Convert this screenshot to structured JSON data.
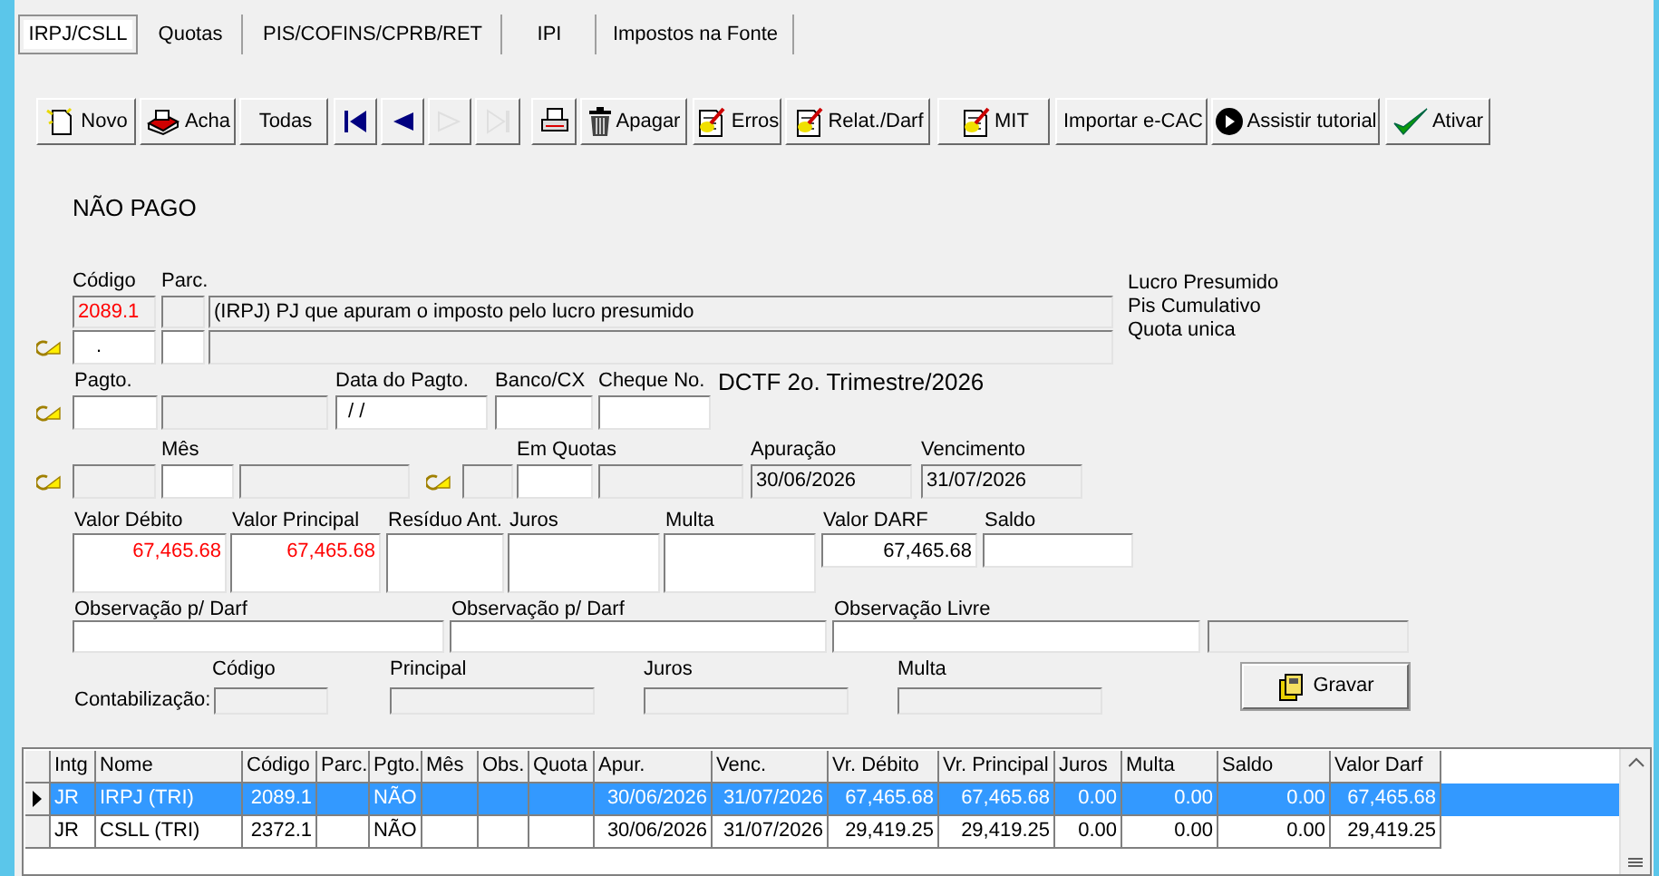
{
  "tabs": [
    {
      "label": "IRPJ/CSLL",
      "selected": true
    },
    {
      "label": "Quotas",
      "selected": false
    },
    {
      "label": "PIS/COFINS/CPRB/RET",
      "selected": false
    },
    {
      "label": "IPI",
      "selected": false
    },
    {
      "label": "Impostos na Fonte",
      "selected": false
    }
  ],
  "toolbar": [
    {
      "label": "Novo",
      "kind": "new",
      "disabled": false
    },
    {
      "label": "Acha",
      "kind": "find",
      "disabled": false
    },
    {
      "label": "Todas",
      "kind": "text",
      "disabled": false
    },
    {
      "kind": "first",
      "disabled": false
    },
    {
      "kind": "prev",
      "disabled": false
    },
    {
      "kind": "next",
      "disabled": true
    },
    {
      "kind": "last",
      "disabled": true
    },
    {
      "kind": "print",
      "disabled": false
    },
    {
      "label": "Apagar",
      "kind": "trash",
      "disabled": false
    },
    {
      "label": "Erros",
      "kind": "doc",
      "disabled": false
    },
    {
      "label": "Relat./Darf",
      "kind": "doc",
      "disabled": false
    },
    {
      "label": "MIT",
      "kind": "doc",
      "disabled": false
    },
    {
      "label": "Importar e-CAC",
      "kind": "text",
      "disabled": false
    },
    {
      "label": "Assistir tutorial",
      "kind": "play",
      "disabled": false
    },
    {
      "label": "Ativar",
      "kind": "check",
      "disabled": false
    }
  ],
  "status": "NÃO PAGO",
  "codigo": {
    "label": "Código",
    "parc_label": "Parc.",
    "value": "2089.1",
    "description": "(IRPJ) PJ que apuram o imposto pelo lucro presumido",
    "input_value": "."
  },
  "regime": [
    "Lucro Presumido",
    "Pis Cumulativo",
    "Quota unica"
  ],
  "pagamento": {
    "pagto_label": "Pagto.",
    "data_label": "Data do Pagto.",
    "data_value": "/ /",
    "banco_label": "Banco/CX",
    "cheque_label": "Cheque No.",
    "dctf": "DCTF 2o. Trimestre/2026"
  },
  "periodo": {
    "mes_label": "Mês",
    "quotas_label": "Em Quotas",
    "apuracao_label": "Apuração",
    "apuracao": "30/06/2026",
    "vencimento_label": "Vencimento",
    "vencimento": "31/07/2026"
  },
  "valores": [
    {
      "label": "Valor Débito",
      "value": "67,465.68",
      "emphasis": true
    },
    {
      "label": "Valor Principal",
      "value": "67,465.68",
      "emphasis": true
    },
    {
      "label": "Resíduo Ant."
    },
    {
      "label": "Juros"
    },
    {
      "label": "Multa"
    },
    {
      "label": "Valor DARF",
      "value": "67,465.68",
      "emphasis": false
    },
    {
      "label": "Saldo"
    }
  ],
  "observacoes": [
    "Observação p/ Darf",
    "Observação p/ Darf",
    "Observação Livre"
  ],
  "contabilizacao": {
    "label": "Contabilização:",
    "columns": [
      "Código",
      "Principal",
      "Juros",
      "Multa"
    ]
  },
  "save_button": "Gravar",
  "table": {
    "columns": [
      "Intg",
      "Nome",
      "Código",
      "Parc.",
      "Pgto.",
      "Mês",
      "Obs.",
      "Quota",
      "Apur.",
      "Venc.",
      "Vr. Débito",
      "Vr. Principal",
      "Juros",
      "Multa",
      "Saldo",
      "Valor Darf"
    ],
    "rows": [
      {
        "selected": true,
        "cells": [
          "JR",
          "IRPJ (TRI)",
          "2089.1",
          null,
          "NÃO",
          null,
          null,
          null,
          "30/06/2026",
          "31/07/2026",
          "67,465.68",
          "67,465.68",
          "0.00",
          "0.00",
          "0.00",
          "67,465.68"
        ]
      },
      {
        "selected": false,
        "cells": [
          "JR",
          "CSLL (TRI)",
          "2372.1",
          null,
          "NÃO",
          null,
          null,
          null,
          "30/06/2026",
          "31/07/2026",
          "29,419.25",
          "29,419.25",
          "0.00",
          "0.00",
          "0.00",
          "29,419.25"
        ]
      }
    ]
  }
}
